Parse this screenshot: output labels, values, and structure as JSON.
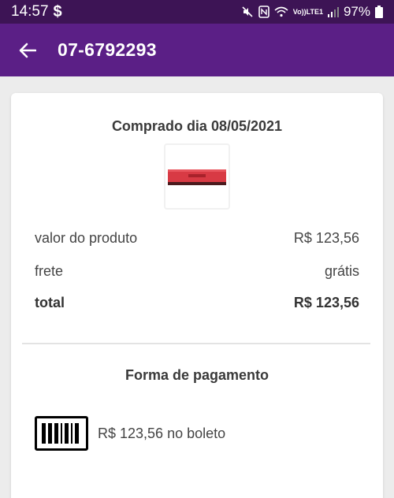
{
  "status_bar": {
    "time": "14:57",
    "dollar_icon": "$",
    "network_label_top": "Vo))",
    "network_label_bottom": "LTE1",
    "battery_percent": "97%"
  },
  "app_bar": {
    "title": "07-6792293"
  },
  "order": {
    "purchased_label": "Comprado dia 08/05/2021",
    "product_image": "red-ram-memory-module",
    "rows": [
      {
        "label": "valor do produto",
        "value": "R$ 123,56"
      },
      {
        "label": "frete",
        "value": "grátis"
      },
      {
        "label": "total",
        "value": "R$ 123,56"
      }
    ]
  },
  "payment": {
    "title": "Forma de pagamento",
    "method_icon": "barcode-icon",
    "method_text": "R$ 123,56 no boleto"
  },
  "colors": {
    "status_bar": "#3d1455",
    "app_bar": "#5b1f86",
    "background": "#ececec",
    "card": "#ffffff",
    "product_red": "#d83a44"
  }
}
